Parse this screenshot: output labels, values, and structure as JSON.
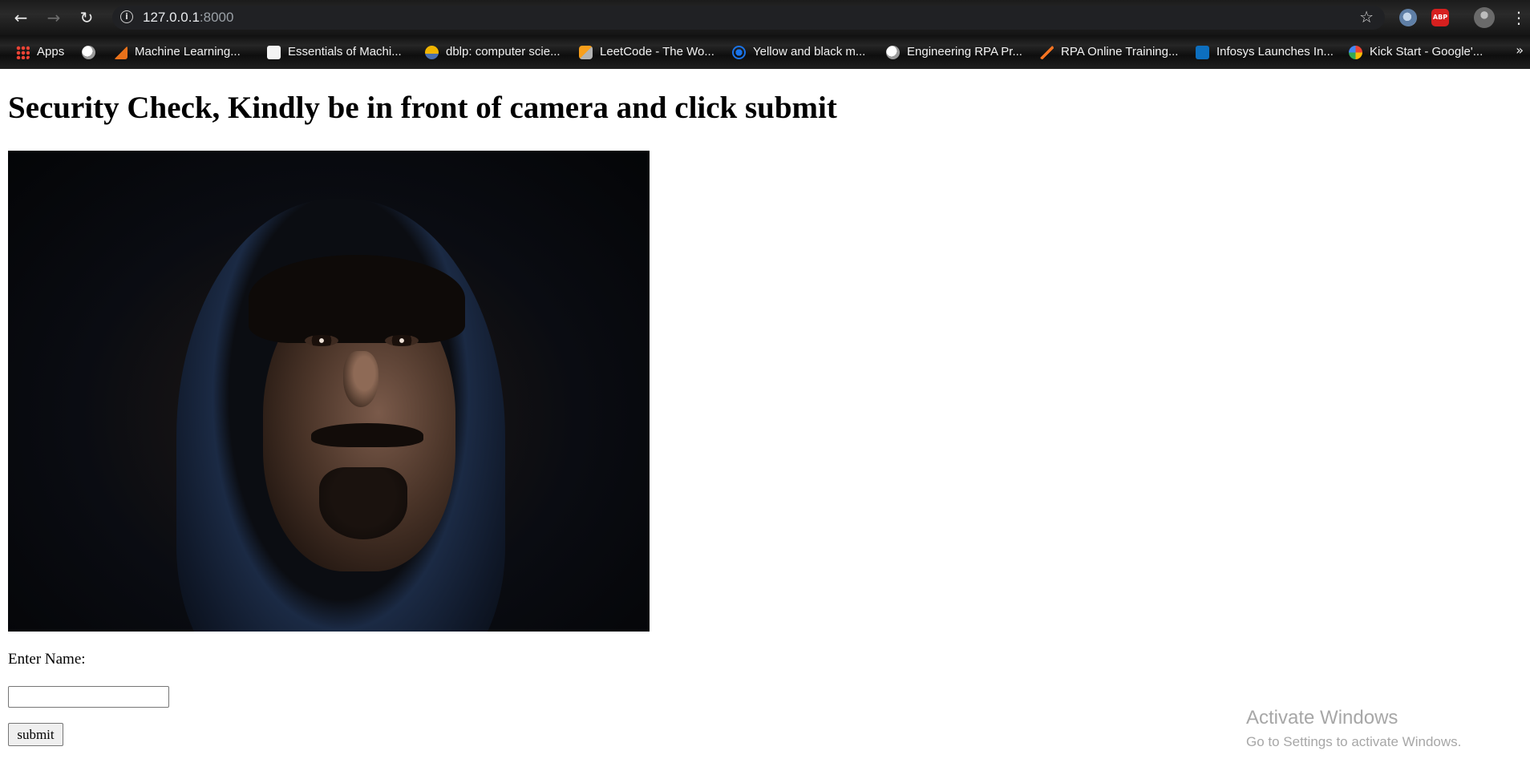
{
  "browser": {
    "url_host": "127.0.0.1",
    "url_port": ":8000",
    "nav": {
      "back_icon": "arrow-left-icon",
      "forward_icon": "arrow-right-icon",
      "reload_icon": "reload-icon"
    },
    "icons": [
      "info-icon",
      "star-icon",
      "globe-extension-icon",
      "adblock-plus-icon",
      "profile-avatar-icon",
      "menu-dots-icon"
    ],
    "abp_label": "ABP"
  },
  "bookmarks": [
    {
      "label": "Apps",
      "icon": "apps-grid-icon"
    },
    {
      "label": "",
      "icon": "globe-icon"
    },
    {
      "label": "Machine Learning...",
      "icon": "ml-icon"
    },
    {
      "label": "Essentials of Machi...",
      "icon": "document-icon"
    },
    {
      "label": "dblp: computer scie...",
      "icon": "dblp-icon"
    },
    {
      "label": "LeetCode - The Wo...",
      "icon": "leetcode-icon"
    },
    {
      "label": "Yellow and black m...",
      "icon": "ship-wheel-icon"
    },
    {
      "label": "Engineering RPA Pr...",
      "icon": "globe-icon"
    },
    {
      "label": "RPA Online Training...",
      "icon": "rpa-icon"
    },
    {
      "label": "Infosys Launches In...",
      "icon": "infosys-icon"
    },
    {
      "label": "Kick Start - Google'...",
      "icon": "google-icon"
    }
  ],
  "bookmark_overflow": "»",
  "page": {
    "heading": "Security Check, Kindly be in front of camera and click submit",
    "name_label": "Enter Name:",
    "name_value": "",
    "submit_label": "submit"
  },
  "windows_watermark": {
    "title": "Activate Windows",
    "subtitle": "Go to Settings to activate Windows."
  }
}
